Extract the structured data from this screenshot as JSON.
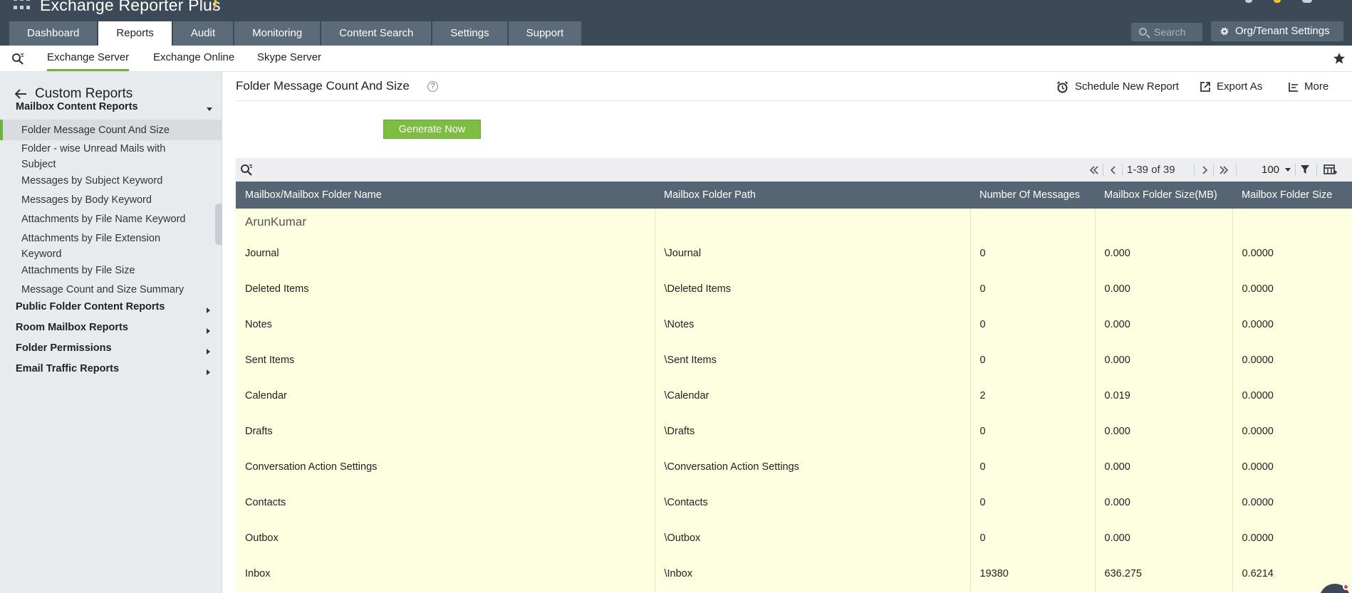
{
  "app": {
    "name": "Exchange Reporter Plus"
  },
  "header": {
    "tabs": [
      {
        "label": "Dashboard",
        "active": false
      },
      {
        "label": "Reports",
        "active": true
      },
      {
        "label": "Audit",
        "active": false
      },
      {
        "label": "Monitoring",
        "active": false
      },
      {
        "label": "Content Search",
        "active": false
      },
      {
        "label": "Settings",
        "active": false
      },
      {
        "label": "Support",
        "active": false
      }
    ],
    "search_placeholder": "Search",
    "org_settings_label": "Org/Tenant Settings"
  },
  "subnav": {
    "tabs": [
      {
        "label": "Exchange Server",
        "active": true
      },
      {
        "label": "Exchange Online",
        "active": false
      },
      {
        "label": "Skype Server",
        "active": false
      }
    ]
  },
  "sidebar": {
    "title": "Custom Reports",
    "groups": [
      {
        "label": "Mailbox Content Reports",
        "expanded": true,
        "items": [
          {
            "label": "Folder Message Count And Size",
            "active": true
          },
          {
            "label": "Folder - wise Unread Mails with Subject",
            "active": false
          },
          {
            "label": "Messages by Subject Keyword",
            "active": false
          },
          {
            "label": "Messages by Body Keyword",
            "active": false
          },
          {
            "label": "Attachments by File Name Keyword",
            "active": false
          },
          {
            "label": "Attachments by File Extension Keyword",
            "active": false
          },
          {
            "label": "Attachments by File Size",
            "active": false
          },
          {
            "label": "Message Count and Size Summary",
            "active": false
          }
        ]
      },
      {
        "label": "Public Folder Content Reports",
        "expanded": false
      },
      {
        "label": "Room Mailbox Reports",
        "expanded": false
      },
      {
        "label": "Folder Permissions",
        "expanded": false
      },
      {
        "label": "Email Traffic Reports",
        "expanded": false
      }
    ]
  },
  "main": {
    "title": "Folder Message Count And Size",
    "help_icon": "?",
    "actions": {
      "schedule": "Schedule New Report",
      "export": "Export As",
      "more": "More"
    },
    "generate_label": "Generate Now",
    "pager": {
      "range": "1-39 of 39",
      "per_page": "100"
    },
    "table": {
      "columns": [
        "Mailbox/Mailbox Folder Name",
        "Mailbox Folder Path",
        "Number Of Messages",
        "Mailbox Folder Size(MB)",
        "Mailbox Folder Size"
      ],
      "group": "ArunKumar",
      "rows": [
        [
          "Journal",
          "\\Journal",
          "0",
          "0.000",
          "0.0000"
        ],
        [
          "Deleted Items",
          "\\Deleted Items",
          "0",
          "0.000",
          "0.0000"
        ],
        [
          "Notes",
          "\\Notes",
          "0",
          "0.000",
          "0.0000"
        ],
        [
          "Sent Items",
          "\\Sent Items",
          "0",
          "0.000",
          "0.0000"
        ],
        [
          "Calendar",
          "\\Calendar",
          "2",
          "0.019",
          "0.0000"
        ],
        [
          "Drafts",
          "\\Drafts",
          "0",
          "0.000",
          "0.0000"
        ],
        [
          "Conversation Action Settings",
          "\\Conversation Action Settings",
          "0",
          "0.000",
          "0.0000"
        ],
        [
          "Contacts",
          "\\Contacts",
          "0",
          "0.000",
          "0.0000"
        ],
        [
          "Outbox",
          "\\Outbox",
          "0",
          "0.000",
          "0.0000"
        ],
        [
          "Inbox",
          "\\Inbox",
          "19380",
          "636.275",
          "0.6214"
        ]
      ]
    }
  },
  "colors": {
    "header_bg": "#3c4a57",
    "tab_bg": "#5b6b79",
    "accent_green": "#6cb33f",
    "table_header_bg": "#566573",
    "row_bg": "#fefee0",
    "sidebar_bg": "#e7ebed"
  }
}
